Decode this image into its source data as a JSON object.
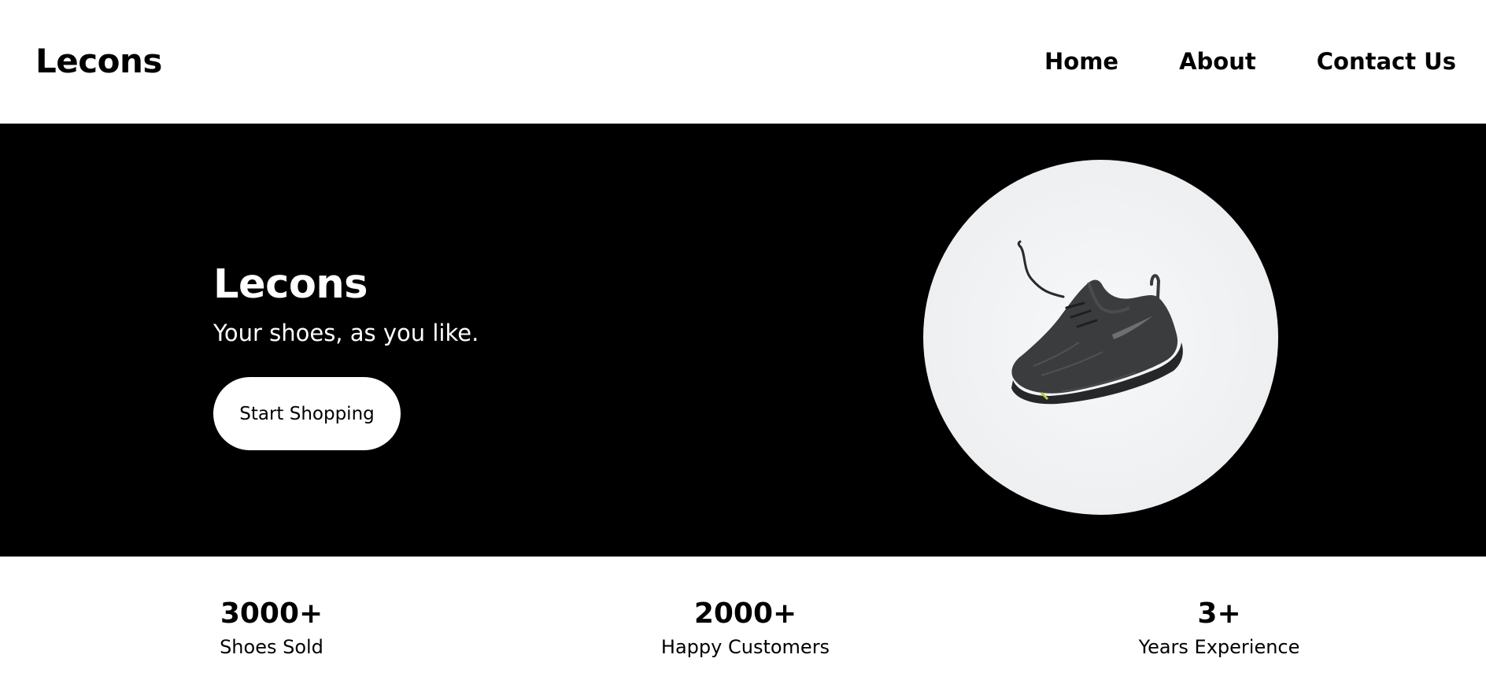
{
  "header": {
    "brand": "Lecons",
    "nav": [
      {
        "label": "Home"
      },
      {
        "label": "About"
      },
      {
        "label": "Contact Us"
      }
    ]
  },
  "hero": {
    "title": "Lecons",
    "subtitle": "Your shoes, as you like.",
    "cta_label": "Start Shopping",
    "image_icon": "sneaker-image"
  },
  "stats": [
    {
      "value": "3000+",
      "label": "Shoes Sold"
    },
    {
      "value": "2000+",
      "label": "Happy Customers"
    },
    {
      "value": "3+",
      "label": "Years Experience"
    }
  ],
  "colors": {
    "background": "#ffffff",
    "hero_background": "#000000",
    "text": "#000000",
    "hero_text": "#ffffff"
  }
}
